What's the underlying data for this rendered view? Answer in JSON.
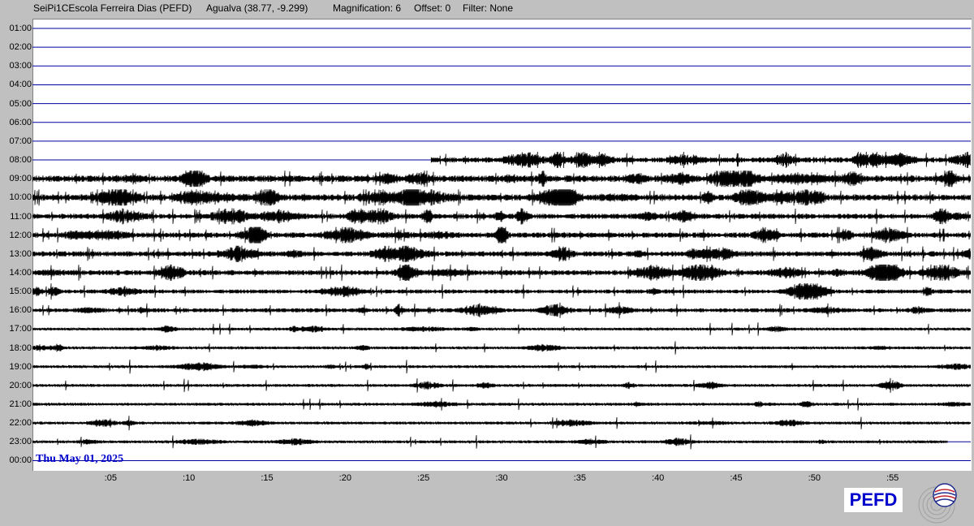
{
  "header": {
    "station": "SeiPi1CEscola Ferreira Dias (PEFD)",
    "location": "Agualva (38.77, -9.299)",
    "magnification": "Magnification: 6",
    "offset": "Offset: 0",
    "filter": "Filter: None"
  },
  "hours": [
    "01:00",
    "02:00",
    "03:00",
    "04:00",
    "05:00",
    "06:00",
    "07:00",
    "08:00",
    "09:00",
    "10:00",
    "11:00",
    "12:00",
    "13:00",
    "14:00",
    "15:00",
    "16:00",
    "17:00",
    "18:00",
    "19:00",
    "20:00",
    "21:00",
    "22:00",
    "23:00",
    "00:00"
  ],
  "minute_ticks": [
    ":05",
    ":10",
    ":15",
    ":20",
    ":25",
    ":30",
    ":35",
    ":40",
    ":45",
    ":50",
    ":55"
  ],
  "date": "Thu May 01, 2025",
  "logo_text": "PEFD",
  "colors": {
    "baseline": "#0000a0",
    "trace": "#000000",
    "date": "#0000cc",
    "background": "#c0c0c0"
  },
  "chart_data": {
    "type": "seismogram",
    "x_unit": "minutes past the hour",
    "x_range": [
      0,
      60
    ],
    "trace_activity": [
      {
        "hour": "01:00",
        "activity": 0
      },
      {
        "hour": "02:00",
        "activity": 0
      },
      {
        "hour": "03:00",
        "activity": 0
      },
      {
        "hour": "04:00",
        "activity": 0
      },
      {
        "hour": "05:00",
        "activity": 0
      },
      {
        "hour": "06:00",
        "activity": 0
      },
      {
        "hour": "07:00",
        "activity": 0
      },
      {
        "hour": "08:00",
        "start_minute": 25.5,
        "activity": 3
      },
      {
        "hour": "09:00",
        "activity": 4
      },
      {
        "hour": "10:00",
        "activity": 4
      },
      {
        "hour": "11:00",
        "activity": 3
      },
      {
        "hour": "12:00",
        "activity": 3
      },
      {
        "hour": "13:00",
        "activity": 3
      },
      {
        "hour": "14:00",
        "activity": 3
      },
      {
        "hour": "15:00",
        "activity": 2
      },
      {
        "hour": "16:00",
        "activity": 2
      },
      {
        "hour": "17:00",
        "activity": 1
      },
      {
        "hour": "18:00",
        "activity": 1
      },
      {
        "hour": "19:00",
        "activity": 1
      },
      {
        "hour": "20:00",
        "activity": 1
      },
      {
        "hour": "21:00",
        "activity": 1
      },
      {
        "hour": "22:00",
        "activity": 1
      },
      {
        "hour": "23:00",
        "end_minute": 58.5,
        "activity": 1
      },
      {
        "hour": "00:00",
        "activity": 0
      }
    ]
  }
}
